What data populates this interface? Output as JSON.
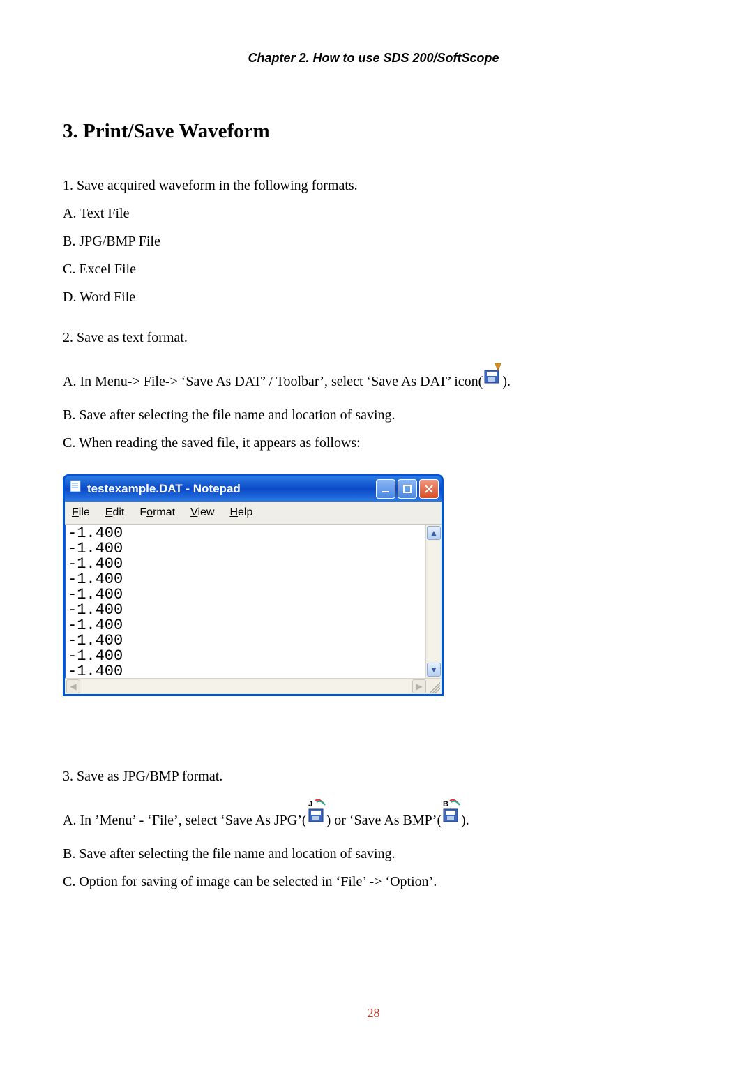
{
  "header": "Chapter 2. How to use SDS 200/SoftScope",
  "sectionTitle": "3. Print/Save Waveform",
  "p1": "1. Save acquired waveform in the following formats.",
  "p1a": "A. Text File",
  "p1b": "B. JPG/BMP File",
  "p1c": "C. Excel File",
  "p1d": "D. Word File",
  "p2": "2. Save as text format.",
  "p2a_pre": "A. In Menu-> File-> ‘Save As DAT’ / Toolbar’, select ‘Save As DAT’ icon(",
  "p2a_post": ").",
  "p2b": "B. Save after selecting the file name and location of saving.",
  "p2c": "C. When reading the saved file, it appears as follows:",
  "notepad": {
    "title": "testexample.DAT - Notepad",
    "menu": {
      "file": "File",
      "edit": "Edit",
      "format": "Format",
      "view": "View",
      "help": "Help"
    },
    "content": "-1.400\n-1.400\n-1.400\n-1.400\n-1.400\n-1.400\n-1.400\n-1.400\n-1.400\n-1.400"
  },
  "p3": "3. Save as JPG/BMP format.",
  "p3a_pre": "A. In ’Menu’ - ‘File’, select ‘Save As JPG’(",
  "p3a_mid": ") or ‘Save As BMP’(",
  "p3a_post": ").",
  "p3b": "B. Save after selecting the file name and location of saving.",
  "p3c": "C. Option for saving of image can be selected in ‘File’ -> ‘Option’.",
  "pageNumber": "28"
}
